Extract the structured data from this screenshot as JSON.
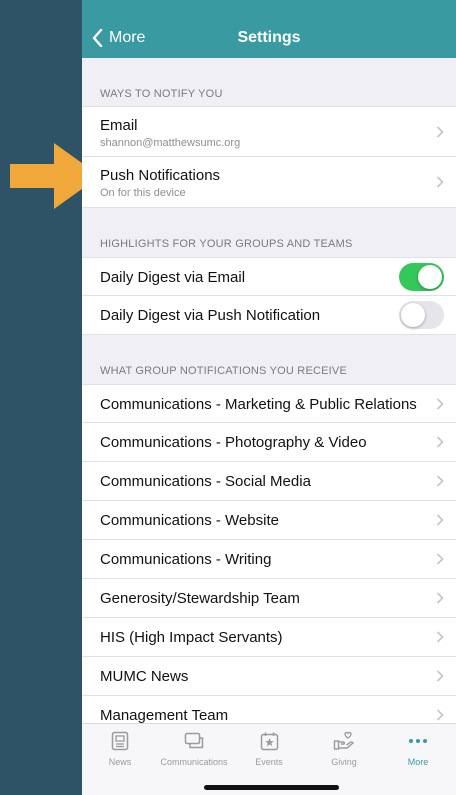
{
  "nav": {
    "back_label": "More",
    "title": "Settings"
  },
  "sections": {
    "notify_header": "WAYS TO NOTIFY YOU",
    "highlights_header": "HIGHLIGHTS FOR YOUR GROUPS AND TEAMS",
    "groups_header": "WHAT GROUP NOTIFICATIONS YOU RECEIVE"
  },
  "notify": [
    {
      "title": "Email",
      "subtitle": "shannon@matthewsumc.org"
    },
    {
      "title": "Push Notifications",
      "subtitle": "On for this device"
    }
  ],
  "highlights": [
    {
      "label": "Daily Digest via Email",
      "enabled": true
    },
    {
      "label": "Daily Digest via Push Notification",
      "enabled": false
    }
  ],
  "groups": [
    "Communications - Marketing & Public Relations",
    "Communications - Photography & Video",
    "Communications - Social Media",
    "Communications - Website",
    "Communications - Writing",
    "Generosity/Stewardship Team",
    "HIS (High Impact Servants)",
    "MUMC News",
    "Management Team"
  ],
  "tabbar": [
    {
      "label": "News",
      "icon": "news-icon"
    },
    {
      "label": "Communications",
      "icon": "chat-icon"
    },
    {
      "label": "Events",
      "icon": "calendar-star-icon"
    },
    {
      "label": "Giving",
      "icon": "giving-hand-icon"
    },
    {
      "label": "More",
      "icon": "more-dots-icon"
    }
  ],
  "colors": {
    "accent": "#3a9aa2",
    "toggle_on": "#34c759",
    "arrow": "#f0a83a",
    "backdrop": "#2e5266"
  }
}
